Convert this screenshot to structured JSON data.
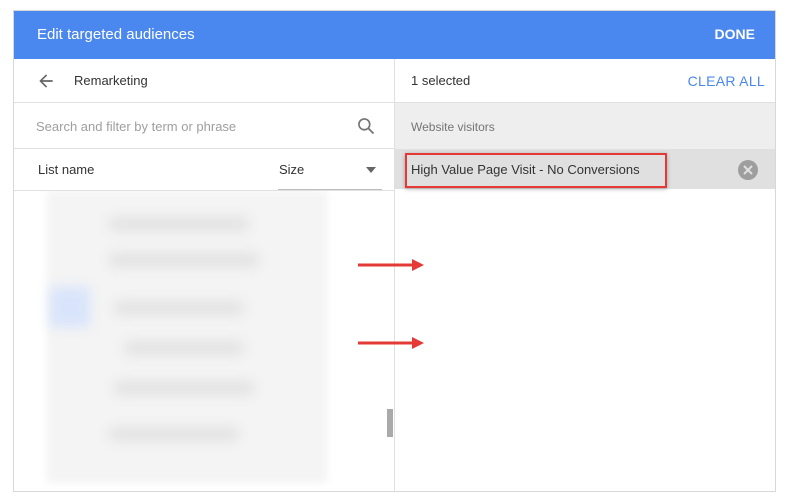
{
  "header": {
    "title": "Edit targeted audiences",
    "done_label": "DONE"
  },
  "left": {
    "back_icon": "arrow-back-icon",
    "nav_title": "Remarketing",
    "search": {
      "placeholder": "Search and filter by term or phrase",
      "value": "",
      "icon": "search-icon"
    },
    "columns": {
      "list_name": "List name",
      "size": "Size"
    }
  },
  "right": {
    "selected_count": "1 selected",
    "clear_all_label": "CLEAR ALL",
    "group_label": "Website visitors",
    "items": [
      {
        "label": "High Value Page Visit - No Conversions",
        "icon": "close-circle-icon"
      }
    ]
  },
  "colors": {
    "header_bg": "#4a87ef",
    "accent": "#4a87ef",
    "annotation_red": "#e53935"
  }
}
